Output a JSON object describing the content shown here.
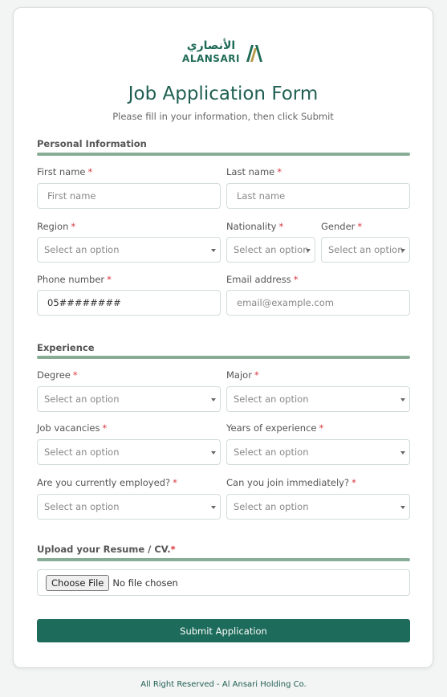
{
  "logo": {
    "arabic": "الأنصاري",
    "english": "ALANSARI"
  },
  "header": {
    "title": "Job Application Form",
    "subtitle": "Please fill in your information, then click Submit"
  },
  "personal": {
    "section_title": "Personal Information",
    "first_name_label": "First name",
    "first_name_placeholder": "First name",
    "last_name_label": "Last name",
    "last_name_placeholder": "Last name",
    "region_label": "Region",
    "region_value": "Select an option",
    "nationality_label": "Nationality",
    "nationality_value": "Select an option",
    "gender_label": "Gender",
    "gender_value": "Select an option",
    "phone_label": "Phone number",
    "phone_value": "05########",
    "email_label": "Email address",
    "email_placeholder": "email@example.com"
  },
  "experience": {
    "section_title": "Experience",
    "degree_label": "Degree",
    "degree_value": "Select an option",
    "major_label": "Major",
    "major_value": "Select an option",
    "vacancies_label": "Job vacancies",
    "vacancies_value": "Select an option",
    "years_label": "Years of experience",
    "years_value": "Select an option",
    "employed_label": "Are you currently employed?",
    "employed_value": "Select an option",
    "join_label": "Can you join immediately?",
    "join_value": "Select an option"
  },
  "upload": {
    "section_title": "Upload your Resume / CV.",
    "button_label": "Choose File",
    "status": "No file chosen"
  },
  "submit_label": "Submit Application",
  "footer": "All Right Reserved - Al Ansari Holding Co.",
  "required_mark": "*",
  "colors": {
    "brand": "#1d6b5b",
    "section_bar": "#87ad97",
    "required": "#d9363e"
  }
}
